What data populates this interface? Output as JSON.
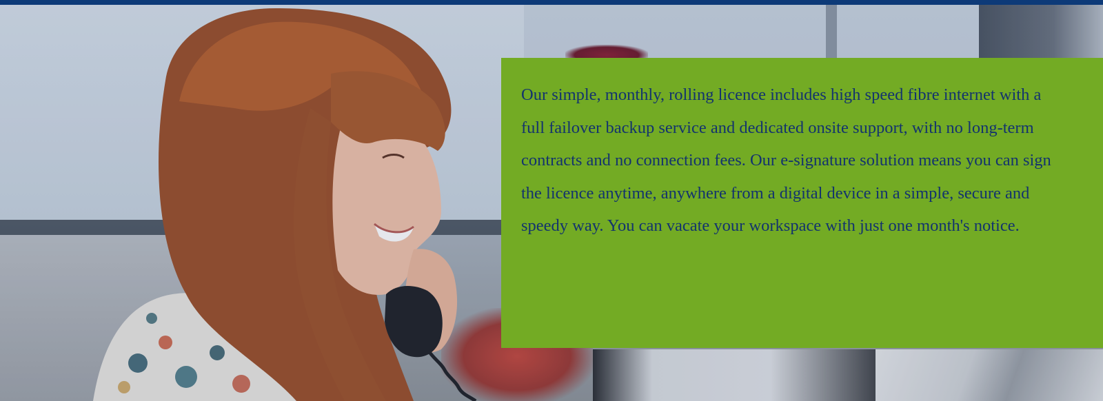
{
  "hero": {
    "photo_alt": "Woman smiling while talking on a desk telephone in an office",
    "panel_color": "#73ab24",
    "text_color": "#13336e",
    "top_bar_color": "#0d3a78"
  },
  "info_panel": {
    "text": "Our simple, monthly, rolling licence includes high speed fibre internet with a full failover backup service and dedicated onsite support, with no long-term contracts and no connection fees.  Our e-signature solution means you can sign the licence anytime, anywhere from a digital device in a simple, secure and speedy way. You can vacate your workspace with just one month's notice."
  }
}
